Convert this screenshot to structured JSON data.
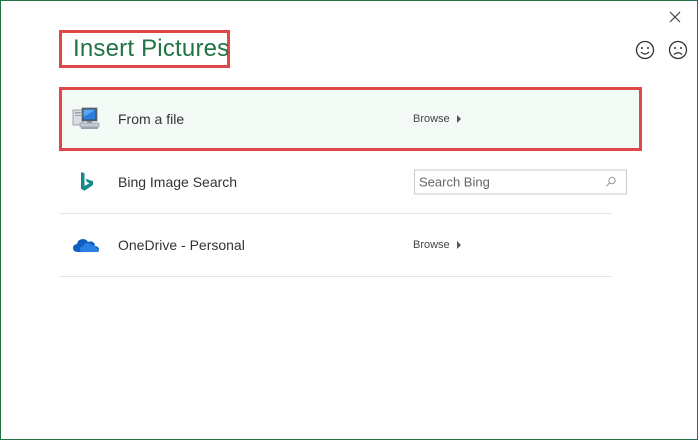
{
  "dialog": {
    "title": "Insert Pictures",
    "accent_color": "#217346",
    "highlight_color": "#e04848"
  },
  "feedback": {
    "smile_icon": "smile-icon",
    "frown_icon": "frown-icon"
  },
  "sources": [
    {
      "label": "From a file",
      "icon": "computer-icon",
      "action_label": "Browse",
      "highlighted": true
    },
    {
      "label": "Bing Image Search",
      "icon": "bing-icon",
      "search_placeholder": "Search Bing"
    },
    {
      "label": "OneDrive - Personal",
      "icon": "onedrive-icon",
      "action_label": "Browse"
    }
  ]
}
